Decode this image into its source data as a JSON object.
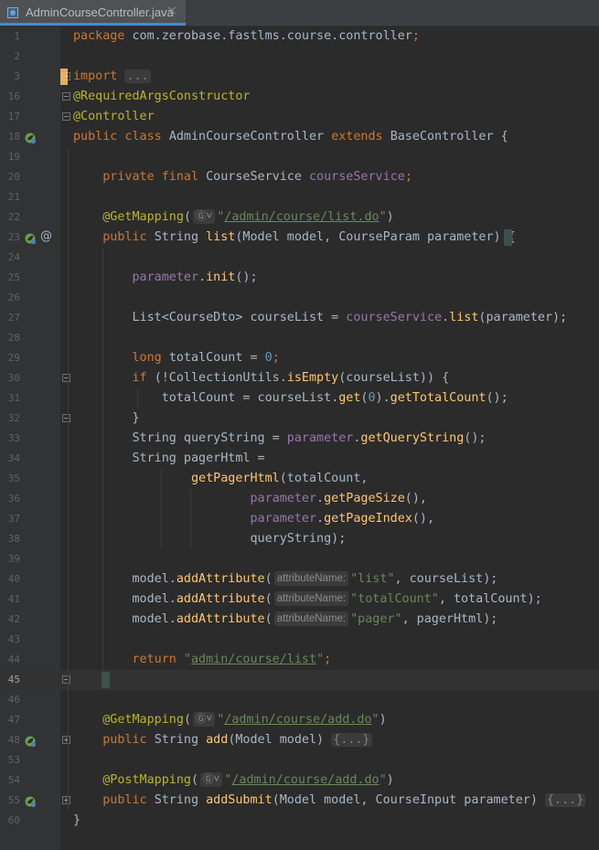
{
  "tab": {
    "filename": "AdminCourseController.java",
    "icon": "java-class-icon",
    "close": "×"
  },
  "colors": {
    "background": "#2b2b2b",
    "gutter": "#313335",
    "keyword": "#cc7832",
    "string": "#6a8759",
    "field": "#9876aa",
    "method": "#ffc66d",
    "annotation": "#bbb529",
    "number": "#6897bb"
  },
  "gutter_icons": {
    "bean": "spring-bean-icon",
    "override": "at-sign-icon"
  },
  "lines": [
    {
      "n": "1",
      "parts": [
        [
          "kw",
          "package "
        ],
        [
          "p",
          "com.zerobase.fastlms.course.controller"
        ],
        [
          "kw",
          ";"
        ]
      ]
    },
    {
      "n": "2",
      "parts": []
    },
    {
      "n": "3",
      "parts": [
        [
          "kw",
          "import "
        ],
        [
          "fold",
          "..."
        ]
      ]
    },
    {
      "n": "16",
      "parts": [
        [
          "an",
          "@RequiredArgsConstructor"
        ]
      ]
    },
    {
      "n": "17",
      "parts": [
        [
          "an",
          "@Controller"
        ]
      ]
    },
    {
      "n": "18",
      "parts": [
        [
          "kw",
          "public class "
        ],
        [
          "p",
          "AdminCourseController "
        ],
        [
          "kw",
          "extends "
        ],
        [
          "p",
          "BaseController {"
        ]
      ]
    },
    {
      "n": "19",
      "parts": []
    },
    {
      "n": "20",
      "parts": [
        [
          "p",
          "    "
        ],
        [
          "kw",
          "private final "
        ],
        [
          "p",
          "CourseService "
        ],
        [
          "fld",
          "courseService"
        ],
        [
          "kw",
          ";"
        ]
      ]
    },
    {
      "n": "21",
      "parts": []
    },
    {
      "n": "22",
      "parts": [
        [
          "p",
          "    "
        ],
        [
          "an",
          "@GetMapping"
        ],
        [
          "p",
          "("
        ],
        [
          "hint",
          "Ⓖ˅"
        ],
        [
          "str",
          "\""
        ],
        [
          "stru",
          "/admin/course/list.do"
        ],
        [
          "str",
          "\""
        ],
        [
          "p",
          ")"
        ]
      ]
    },
    {
      "n": "23",
      "parts": [
        [
          "p",
          "    "
        ],
        [
          "kw",
          "public "
        ],
        [
          "p",
          "String "
        ],
        [
          "fn",
          "list"
        ],
        [
          "p",
          "(Model model, CourseParam parameter) {"
        ]
      ]
    },
    {
      "n": "24",
      "parts": []
    },
    {
      "n": "25",
      "parts": [
        [
          "p",
          "        "
        ],
        [
          "fld",
          "parameter"
        ],
        [
          "p",
          "."
        ],
        [
          "mc",
          "init"
        ],
        [
          "p",
          "();"
        ]
      ]
    },
    {
      "n": "26",
      "parts": []
    },
    {
      "n": "27",
      "parts": [
        [
          "p",
          "        List<CourseDto> courseList = "
        ],
        [
          "fld",
          "courseService"
        ],
        [
          "p",
          "."
        ],
        [
          "mc",
          "list"
        ],
        [
          "p",
          "(parameter);"
        ]
      ]
    },
    {
      "n": "28",
      "parts": []
    },
    {
      "n": "29",
      "parts": [
        [
          "p",
          "        "
        ],
        [
          "kw",
          "long "
        ],
        [
          "p",
          "totalCount = "
        ],
        [
          "num",
          "0"
        ],
        [
          "kw",
          ";"
        ]
      ]
    },
    {
      "n": "30",
      "parts": [
        [
          "p",
          "        "
        ],
        [
          "kw",
          "if "
        ],
        [
          "p",
          "(!CollectionUtils."
        ],
        [
          "mc",
          "isEmpty"
        ],
        [
          "p",
          "(courseList)) {"
        ]
      ]
    },
    {
      "n": "31",
      "parts": [
        [
          "p",
          "            totalCount = courseList."
        ],
        [
          "mc",
          "get"
        ],
        [
          "p",
          "("
        ],
        [
          "num",
          "0"
        ],
        [
          "p",
          ")."
        ],
        [
          "mc",
          "getTotalCount"
        ],
        [
          "p",
          "();"
        ]
      ]
    },
    {
      "n": "32",
      "parts": [
        [
          "p",
          "        }"
        ]
      ]
    },
    {
      "n": "33",
      "parts": [
        [
          "p",
          "        String queryString = "
        ],
        [
          "fld",
          "parameter"
        ],
        [
          "p",
          "."
        ],
        [
          "mc",
          "getQueryString"
        ],
        [
          "p",
          "();"
        ]
      ]
    },
    {
      "n": "34",
      "parts": [
        [
          "p",
          "        String pagerHtml ="
        ]
      ]
    },
    {
      "n": "35",
      "parts": [
        [
          "p",
          "                "
        ],
        [
          "mc",
          "getPagerHtml"
        ],
        [
          "p",
          "(totalCount,"
        ]
      ]
    },
    {
      "n": "36",
      "parts": [
        [
          "p",
          "                        "
        ],
        [
          "fld",
          "parameter"
        ],
        [
          "p",
          "."
        ],
        [
          "mc",
          "getPageSize"
        ],
        [
          "p",
          "(),"
        ]
      ]
    },
    {
      "n": "37",
      "parts": [
        [
          "p",
          "                        "
        ],
        [
          "fld",
          "parameter"
        ],
        [
          "p",
          "."
        ],
        [
          "mc",
          "getPageIndex"
        ],
        [
          "p",
          "(),"
        ]
      ]
    },
    {
      "n": "38",
      "parts": [
        [
          "p",
          "                        queryString);"
        ]
      ]
    },
    {
      "n": "39",
      "parts": []
    },
    {
      "n": "40",
      "parts": [
        [
          "p",
          "        model."
        ],
        [
          "mc",
          "addAttribute"
        ],
        [
          "p",
          "("
        ],
        [
          "hint",
          "attributeName:"
        ],
        [
          "str",
          "\"list\""
        ],
        [
          "p",
          ", courseList);"
        ]
      ]
    },
    {
      "n": "41",
      "parts": [
        [
          "p",
          "        model."
        ],
        [
          "mc",
          "addAttribute"
        ],
        [
          "p",
          "("
        ],
        [
          "hint",
          "attributeName:"
        ],
        [
          "str",
          "\"totalCount\""
        ],
        [
          "p",
          ", totalCount);"
        ]
      ]
    },
    {
      "n": "42",
      "parts": [
        [
          "p",
          "        model."
        ],
        [
          "mc",
          "addAttribute"
        ],
        [
          "p",
          "("
        ],
        [
          "hint",
          "attributeName:"
        ],
        [
          "str",
          "\"pager\""
        ],
        [
          "p",
          ", pagerHtml);"
        ]
      ]
    },
    {
      "n": "43",
      "parts": []
    },
    {
      "n": "44",
      "parts": [
        [
          "p",
          "        "
        ],
        [
          "kw",
          "return "
        ],
        [
          "str",
          "\""
        ],
        [
          "stru",
          "admin/course/list"
        ],
        [
          "str",
          "\""
        ],
        [
          "kw",
          ";"
        ]
      ]
    },
    {
      "n": "45",
      "parts": [
        [
          "p",
          "    }"
        ]
      ]
    },
    {
      "n": "46",
      "parts": []
    },
    {
      "n": "47",
      "parts": [
        [
          "p",
          "    "
        ],
        [
          "an",
          "@GetMapping"
        ],
        [
          "p",
          "("
        ],
        [
          "hint",
          "Ⓖ˅"
        ],
        [
          "str",
          "\""
        ],
        [
          "stru",
          "/admin/course/add.do"
        ],
        [
          "str",
          "\""
        ],
        [
          "p",
          ")"
        ]
      ]
    },
    {
      "n": "48",
      "parts": [
        [
          "p",
          "    "
        ],
        [
          "kw",
          "public "
        ],
        [
          "p",
          "String "
        ],
        [
          "fn",
          "add"
        ],
        [
          "p",
          "(Model model) "
        ],
        [
          "fold",
          "{...}"
        ]
      ]
    },
    {
      "n": "53",
      "parts": []
    },
    {
      "n": "54",
      "parts": [
        [
          "p",
          "    "
        ],
        [
          "an",
          "@PostMapping"
        ],
        [
          "p",
          "("
        ],
        [
          "hint",
          "Ⓖ˅"
        ],
        [
          "str",
          "\""
        ],
        [
          "stru",
          "/admin/course/add.do"
        ],
        [
          "str",
          "\""
        ],
        [
          "p",
          ")"
        ]
      ]
    },
    {
      "n": "55",
      "parts": [
        [
          "p",
          "    "
        ],
        [
          "kw",
          "public "
        ],
        [
          "p",
          "String "
        ],
        [
          "fn",
          "addSubmit"
        ],
        [
          "p",
          "(Model model, CourseInput parameter) "
        ],
        [
          "fold",
          "{...}"
        ]
      ]
    },
    {
      "n": "60",
      "parts": [
        [
          "p",
          "}"
        ]
      ]
    }
  ]
}
